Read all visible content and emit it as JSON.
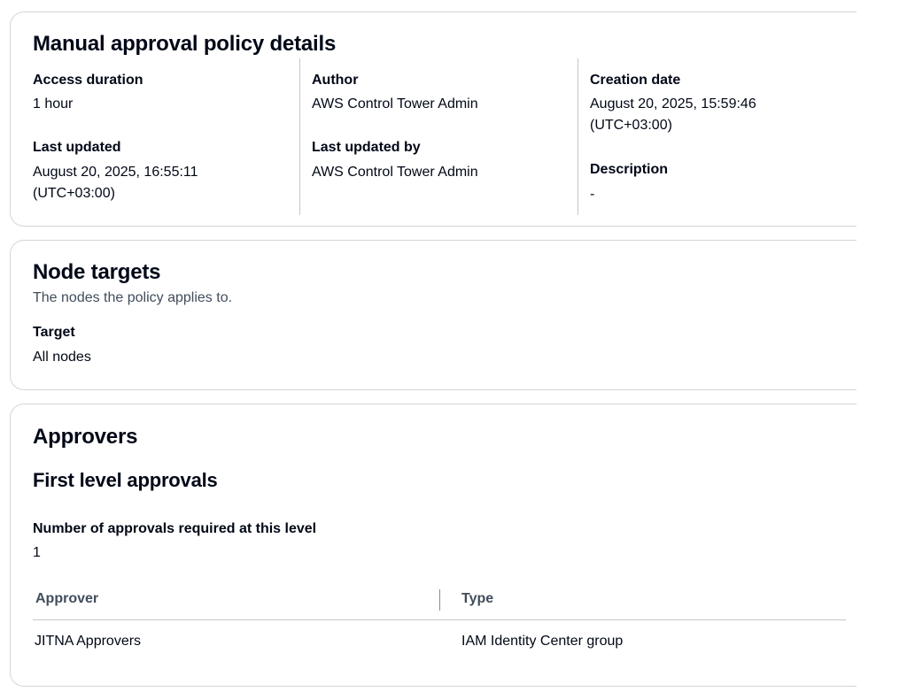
{
  "policy_details": {
    "title": "Manual approval policy details",
    "fields": [
      {
        "label": "Access duration",
        "value": "1 hour"
      },
      {
        "label": "Author",
        "value": "AWS Control Tower Admin"
      },
      {
        "label": "Creation date",
        "value": "August 20, 2025, 15:59:46 (UTC+03:00)"
      },
      {
        "label": "Last updated",
        "value": "August 20, 2025, 16:55:11 (UTC+03:00)"
      },
      {
        "label": "Last updated by",
        "value": "AWS Control Tower Admin"
      },
      {
        "label": "Description",
        "value": "-"
      }
    ]
  },
  "node_targets": {
    "title": "Node targets",
    "subtitle": "The nodes the policy applies to.",
    "target_label": "Target",
    "target_value": "All nodes"
  },
  "approvers": {
    "title": "Approvers",
    "level_title": "First level approvals",
    "required_label": "Number of approvals required at this level",
    "required_value": "1",
    "columns": [
      "Approver",
      "Type"
    ],
    "rows": [
      {
        "approver": "JITNA Approvers",
        "type": "IAM Identity Center group"
      }
    ]
  }
}
